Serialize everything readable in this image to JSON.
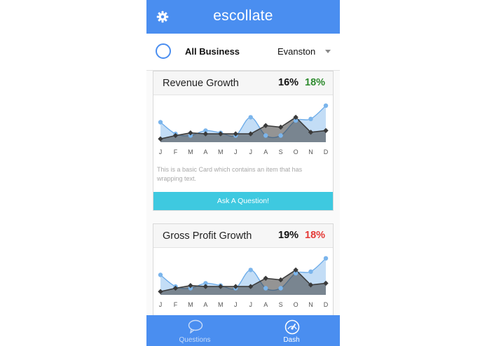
{
  "header": {
    "title": "escollate",
    "settings_icon": "gear-icon"
  },
  "filter": {
    "business": "All Business",
    "location": "Evanston"
  },
  "months": [
    "J",
    "F",
    "M",
    "A",
    "M",
    "J",
    "J",
    "A",
    "S",
    "O",
    "N",
    "D"
  ],
  "colors": {
    "header": "#4a8ef0",
    "cta": "#3ec9e0",
    "positive": "#2e8b2e",
    "negative": "#e53935",
    "series_light": "#6aaae8",
    "series_dark": "#3d3d3d"
  },
  "cards": [
    {
      "title": "Revenue Growth",
      "pct_primary": "16%",
      "pct_secondary": "18%",
      "pct_secondary_color": "#2e8b2e",
      "body": "This is a basic Card which contains an item that has wrapping text.",
      "cta": "Ask A Question!"
    },
    {
      "title": "Gross Profit Growth",
      "pct_primary": "19%",
      "pct_secondary": "18%",
      "pct_secondary_color": "#e53935"
    }
  ],
  "chart_data": [
    {
      "type": "area",
      "categories": [
        "J",
        "F",
        "M",
        "A",
        "M",
        "J",
        "J",
        "A",
        "S",
        "O",
        "N",
        "D"
      ],
      "series": [
        {
          "values": [
            6,
            2.5,
            2,
            3.5,
            2.8,
            2,
            7.5,
            2,
            2,
            6.5,
            7,
            11
          ]
        },
        {
          "values": [
            1,
            2,
            2.8,
            2.5,
            2.5,
            2.5,
            2.5,
            5,
            4.5,
            7.5,
            3,
            3.5
          ]
        }
      ],
      "ylim": [
        0,
        12
      ]
    },
    {
      "type": "area",
      "categories": [
        "J",
        "F",
        "M",
        "A",
        "M",
        "J",
        "J",
        "A",
        "S",
        "O",
        "N",
        "D"
      ],
      "series": [
        {
          "values": [
            6,
            2.5,
            2,
            3.5,
            2.8,
            2,
            7.5,
            2,
            2,
            6.5,
            7,
            11
          ]
        },
        {
          "values": [
            1,
            2,
            2.8,
            2.5,
            2.5,
            2.5,
            2.5,
            5,
            4.5,
            7.5,
            3,
            3.5
          ]
        }
      ],
      "ylim": [
        0,
        12
      ]
    }
  ],
  "tabs": [
    {
      "label": "Questions",
      "icon": "chat-bubble-icon"
    },
    {
      "label": "Dash",
      "icon": "speedometer-icon"
    }
  ]
}
